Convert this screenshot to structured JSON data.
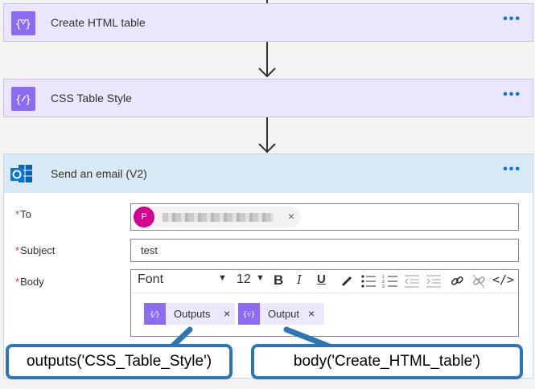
{
  "steps": [
    {
      "title": "Create HTML table",
      "more": "•••"
    },
    {
      "title": "CSS Table Style",
      "more": "•••"
    }
  ],
  "email": {
    "title": "Send an email (V2)",
    "more": "•••",
    "to_label": "To",
    "required_mark": "*",
    "to_avatar": "P",
    "to_remove": "×",
    "subject_label": "Subject",
    "subject_value": "test",
    "body_label": "Body",
    "toolbar": {
      "font": "Font",
      "size": "12",
      "bold": "B",
      "italic": "I",
      "underline": "U",
      "code": "</>"
    },
    "tokens": [
      {
        "label": "Outputs",
        "remove": "×"
      },
      {
        "label": "Output",
        "remove": "×"
      }
    ]
  },
  "callouts": [
    "outputs('CSS_Table_Style')",
    "body('Create_HTML_table')"
  ],
  "colors": {
    "accent": "#0078d4",
    "purple_icon": "#8c6cf2",
    "callout_border": "#2e75b6"
  }
}
